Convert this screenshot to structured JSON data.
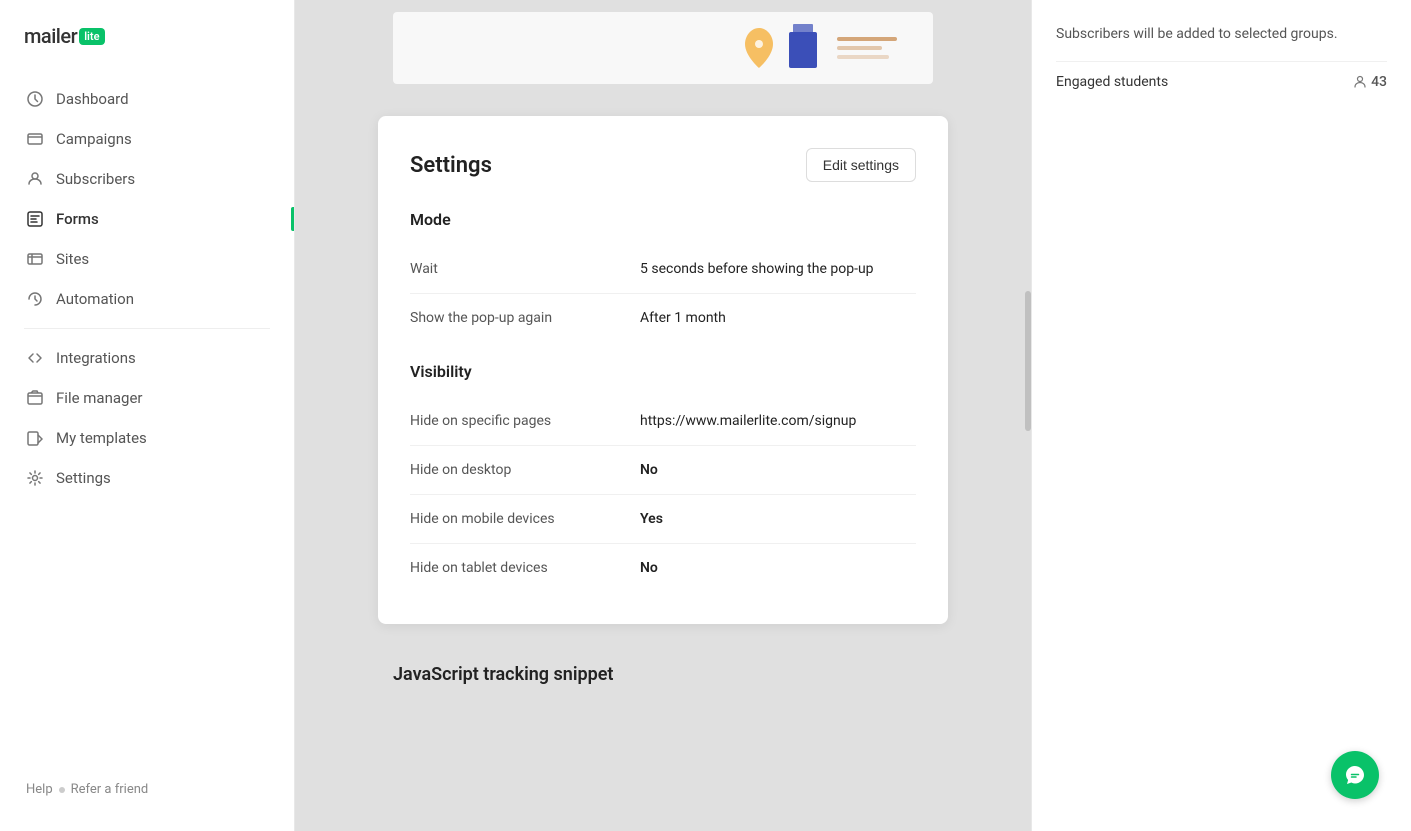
{
  "logo": {
    "text": "mailer",
    "badge": "lite"
  },
  "sidebar": {
    "items": [
      {
        "id": "dashboard",
        "label": "Dashboard",
        "icon": "dashboard-icon",
        "active": false
      },
      {
        "id": "campaigns",
        "label": "Campaigns",
        "icon": "campaigns-icon",
        "active": false
      },
      {
        "id": "subscribers",
        "label": "Subscribers",
        "icon": "subscribers-icon",
        "active": false
      },
      {
        "id": "forms",
        "label": "Forms",
        "icon": "forms-icon",
        "active": true
      },
      {
        "id": "sites",
        "label": "Sites",
        "icon": "sites-icon",
        "active": false
      },
      {
        "id": "automation",
        "label": "Automation",
        "icon": "automation-icon",
        "active": false
      },
      {
        "id": "integrations",
        "label": "Integrations",
        "icon": "integrations-icon",
        "active": false
      },
      {
        "id": "file-manager",
        "label": "File manager",
        "icon": "file-manager-icon",
        "active": false
      },
      {
        "id": "my-templates",
        "label": "My templates",
        "icon": "templates-icon",
        "active": false
      },
      {
        "id": "settings",
        "label": "Settings",
        "icon": "settings-icon",
        "active": false
      }
    ],
    "help": "Help",
    "refer": "Refer a friend"
  },
  "right_panel": {
    "subscribers_note": "Subscribers will be added to selected groups.",
    "group": {
      "name": "Engaged students",
      "count": "43"
    }
  },
  "settings_card": {
    "title": "Settings",
    "edit_button": "Edit settings",
    "mode_section": "Mode",
    "rows": [
      {
        "label": "Wait",
        "value": "5 seconds before showing the pop-up",
        "bold": false
      },
      {
        "label": "Show the pop-up again",
        "value": "After 1 month",
        "bold": false
      }
    ],
    "visibility_section": "Visibility",
    "visibility_rows": [
      {
        "label": "Hide on specific pages",
        "value": "https://www.mailerlite.com/signup",
        "bold": false
      },
      {
        "label": "Hide on desktop",
        "value": "No",
        "bold": true
      },
      {
        "label": "Hide on mobile devices",
        "value": "Yes",
        "bold": true
      },
      {
        "label": "Hide on tablet devices",
        "value": "No",
        "bold": true
      }
    ]
  },
  "js_section": {
    "title": "JavaScript tracking snippet"
  },
  "chat": {
    "icon": "chat-icon"
  }
}
